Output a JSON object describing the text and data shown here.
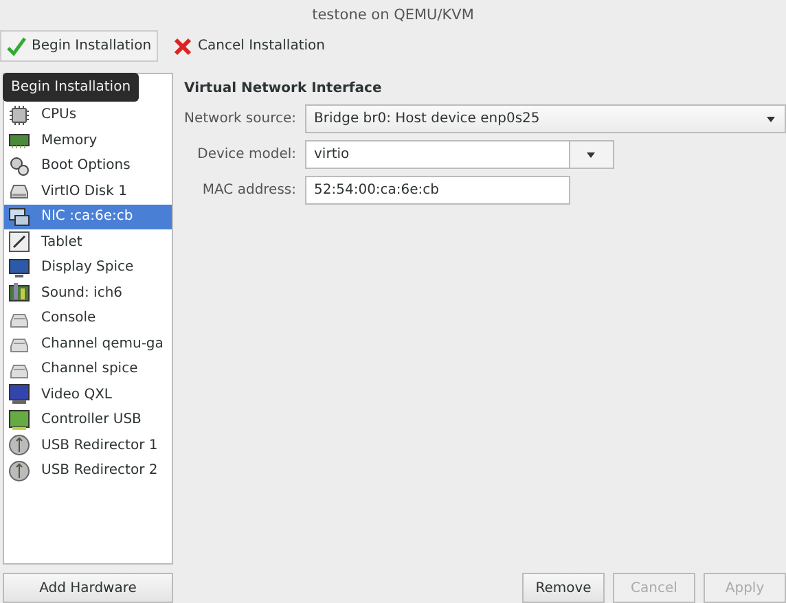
{
  "window": {
    "title": "testone on QEMU/KVM"
  },
  "toolbar": [
    {
      "label": "Begin Installation",
      "kind": "begin",
      "pressed": true
    },
    {
      "label": "Cancel Installation",
      "kind": "cancel",
      "pressed": false
    }
  ],
  "tooltip": "Begin Installation",
  "hardware_list": [
    {
      "selected": false
    },
    {
      "label": "CPUs",
      "selected": false
    },
    {
      "label": "Memory",
      "selected": false
    },
    {
      "label": "Boot Options",
      "selected": false
    },
    {
      "label": "VirtIO Disk 1",
      "selected": false
    },
    {
      "label": "NIC :ca:6e:cb",
      "selected": true
    },
    {
      "label": "Tablet",
      "selected": false
    },
    {
      "label": "Display Spice",
      "selected": false
    },
    {
      "label": "Sound: ich6",
      "selected": false
    },
    {
      "label": "Console",
      "selected": false
    },
    {
      "label": "Channel qemu-ga",
      "selected": false
    },
    {
      "label": "Channel spice",
      "selected": false
    },
    {
      "label": "Video QXL",
      "selected": false
    },
    {
      "label": "Controller USB",
      "selected": false
    },
    {
      "label": "USB Redirector 1",
      "selected": false
    },
    {
      "label": "USB Redirector 2",
      "selected": false
    }
  ],
  "add_hardware": "Add Hardware",
  "details": {
    "heading": "Virtual Network Interface",
    "network_source": {
      "label": "Network source:",
      "value": "Bridge br0: Host device enp0s25"
    },
    "device_model": {
      "label": "Device model:",
      "value": "virtio"
    },
    "mac_address": {
      "label": "MAC address:",
      "value": "52:54:00:ca:6e:cb"
    }
  },
  "buttons": [
    {
      "label": "Remove",
      "disabled": false
    },
    {
      "label": "Cancel",
      "disabled": true
    },
    {
      "label": "Apply",
      "disabled": true
    }
  ]
}
